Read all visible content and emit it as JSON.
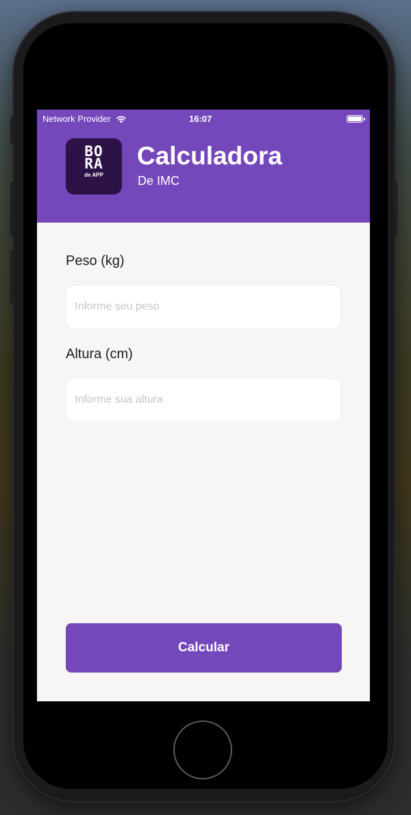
{
  "status_bar": {
    "carrier": "Network Provider",
    "time": "16:07",
    "wifi_icon": "wifi-icon",
    "battery_icon": "battery-icon"
  },
  "header": {
    "logo": {
      "line1": "BO",
      "line2": "RA",
      "line3": "de APP"
    },
    "title": "Calculadora",
    "subtitle": "De IMC",
    "background_color": "#7447bb"
  },
  "form": {
    "weight": {
      "label": "Peso (kg)",
      "placeholder": "Informe seu peso",
      "value": ""
    },
    "height": {
      "label": "Altura (cm)",
      "placeholder": "Informe sua altura",
      "value": ""
    }
  },
  "actions": {
    "calculate_label": "Calcular",
    "button_color": "#7447bb"
  }
}
